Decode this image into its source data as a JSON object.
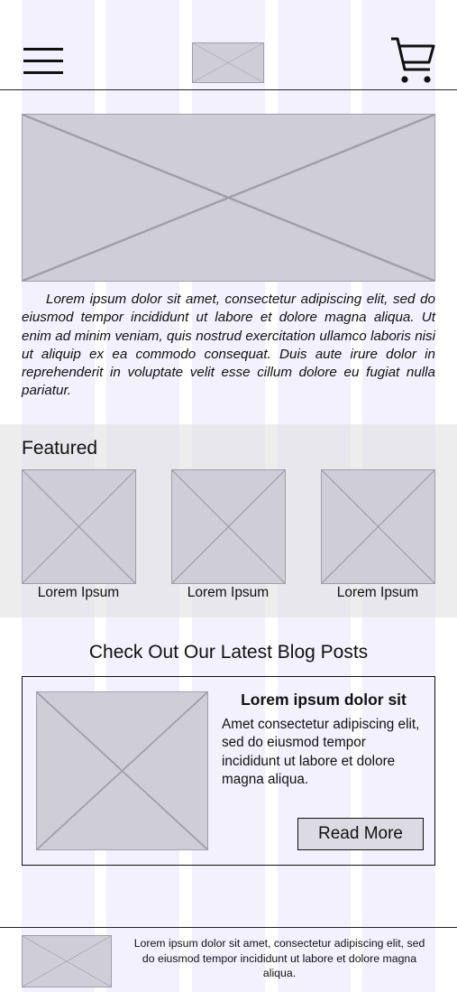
{
  "header": {
    "menu_icon": "hamburger-menu-icon",
    "logo": "logo-placeholder-image",
    "cart_icon": "shopping-cart-icon"
  },
  "hero": {
    "image": "hero-placeholder-image",
    "text": "Lorem ipsum dolor sit amet, consectetur adipiscing elit, sed do eiusmod tempor incididunt ut labore et dolore magna aliqua. Ut enim ad minim veniam, quis nostrud exercitation ullamco laboris nisi ut aliquip ex ea commodo consequat. Duis aute irure dolor in reprehenderit in voluptate velit esse cillum dolore eu fugiat nulla pariatur."
  },
  "featured": {
    "title": "Featured",
    "items": [
      {
        "label": "Lorem Ipsum"
      },
      {
        "label": "Lorem Ipsum"
      },
      {
        "label": "Lorem Ipsum"
      }
    ]
  },
  "blog": {
    "heading": "Check Out Our Latest Blog Posts",
    "post": {
      "title": "Lorem ipsum dolor sit",
      "excerpt": "Amet consectetur adipiscing elit, sed do eiusmod tempor incididunt ut labore et dolore magna aliqua.",
      "button_label": "Read More"
    }
  },
  "footer": {
    "text": "Lorem ipsum dolor sit amet, consectetur adipiscing elit, sed do eiusmod tempor incididunt ut labore et dolore magna aliqua."
  },
  "colors": {
    "grid_column": "#f2f1fd",
    "placeholder_fill": "#cfced8",
    "placeholder_stroke": "#9f9eab",
    "band": "#dedede"
  }
}
